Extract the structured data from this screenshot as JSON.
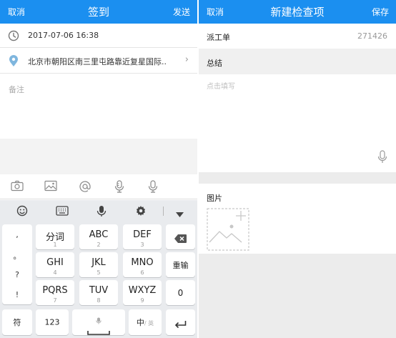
{
  "checkin": {
    "nav": {
      "cancel": "取消",
      "title": "签到",
      "send": "发送"
    },
    "time": "2017-07-06 16:38",
    "location": "北京市朝阳区南三里屯路靠近复星国际..",
    "remark_placeholder": "备注",
    "tool_icons": [
      "camera-icon",
      "image-icon",
      "at-icon",
      "microphone-icon",
      "voice-icon"
    ]
  },
  "keyboard": {
    "top_icons": [
      "emoji-icon",
      "keyboard-icon",
      "microphone-icon",
      "settings-icon",
      "collapse-icon"
    ],
    "punctuation": [
      ",",
      "。",
      "?",
      "!"
    ],
    "keys": [
      {
        "label": "分词",
        "sub": "1"
      },
      {
        "label": "ABC",
        "sub": "2"
      },
      {
        "label": "DEF",
        "sub": "3"
      },
      {
        "label": "GHI",
        "sub": "4"
      },
      {
        "label": "JKL",
        "sub": "5"
      },
      {
        "label": "MNO",
        "sub": "6"
      },
      {
        "label": "PQRS",
        "sub": "7"
      },
      {
        "label": "TUV",
        "sub": "8"
      },
      {
        "label": "WXYZ",
        "sub": "9"
      }
    ],
    "side": {
      "delete": "delete-icon",
      "reenter": "重输",
      "zero": "0"
    },
    "bottom": {
      "symbols": "符",
      "numbers": "123",
      "lang_main": "中",
      "lang_sub": "/ 英",
      "enter": "enter-icon"
    }
  },
  "inspection": {
    "nav": {
      "cancel": "取消",
      "title": "新建检查项",
      "save": "保存"
    },
    "dispatch_label": "派工单",
    "dispatch_value": "271426",
    "summary_label": "总结",
    "summary_placeholder": "点击填写",
    "photo_label": "图片",
    "add_photo_icon": "add-photo-icon"
  },
  "colors": {
    "nav": "#1b8ff0",
    "keyboard_bg": "#e9ebee",
    "page_bg": "#ececec"
  }
}
